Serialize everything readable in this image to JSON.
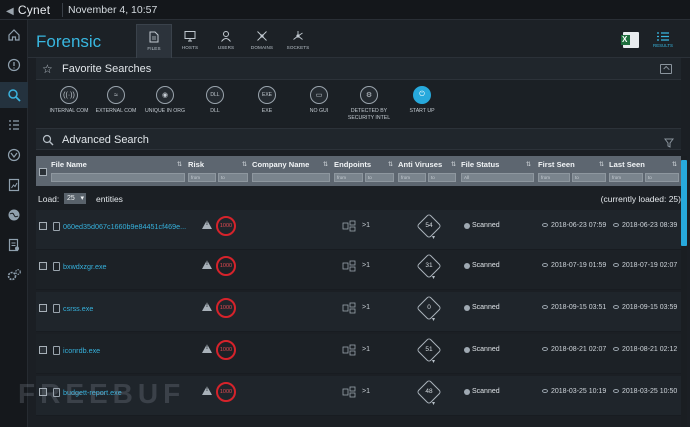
{
  "app": {
    "brand": "Cynet",
    "date": "November 4, 10:57"
  },
  "header": {
    "title": "Forensic",
    "tabs": [
      {
        "label": "FILES",
        "active": true
      },
      {
        "label": "HOSTS"
      },
      {
        "label": "USERS"
      },
      {
        "label": "DOMAINS"
      },
      {
        "label": "SOCKETS"
      }
    ],
    "results_label": "RESULTS"
  },
  "sidebar": {
    "icons": [
      "home-icon",
      "alert-icon",
      "search-icon",
      "list-icon",
      "target-icon",
      "report-icon",
      "globe-icon",
      "document-icon",
      "settings-icon"
    ],
    "active": 2
  },
  "favorites": {
    "title": "Favorite Searches",
    "items": [
      {
        "label": "INTERNAL COM",
        "glyph": "((·))"
      },
      {
        "label": "EXTERNAL COM",
        "glyph": "≈"
      },
      {
        "label": "UNIQUE IN ORG",
        "glyph": "◉"
      },
      {
        "label": "DLL",
        "glyph": "DLL"
      },
      {
        "label": "EXE",
        "glyph": "EXE"
      },
      {
        "label": "NO GUI",
        "glyph": "▭"
      },
      {
        "label": "DETECTED BY SECURITY INTEL",
        "glyph": "⚙"
      },
      {
        "label": "START UP",
        "glyph": "⏻",
        "active": true
      }
    ]
  },
  "advanced": {
    "title": "Advanced Search"
  },
  "table": {
    "columns": [
      "File Name",
      "Risk",
      "Company Name",
      "Endpoints",
      "Anti Viruses",
      "File Status",
      "First Seen",
      "Last Seen"
    ],
    "filters": {
      "risk_from": "from",
      "risk_to": "to",
      "ep_from": "from",
      "ep_to": "to",
      "av_from": "from",
      "av_to": "to",
      "status": "All",
      "fs_from": "from",
      "fs_to": "to",
      "ls_from": "from",
      "ls_to": "to"
    },
    "load_label": "Load:",
    "load_value": "25",
    "entities_label": "entities",
    "loaded_text": "(currently loaded: 25)",
    "rows": [
      {
        "name": "060ed35d067c1660b9e84451cf469e...",
        "risk": "1000",
        "endpoints": "1",
        "av": "54",
        "status": "Scanned",
        "first": "2018-06-23 07:59",
        "last": "2018-06-23 08:39"
      },
      {
        "name": "bxwdxzgr.exe",
        "risk": "1000",
        "endpoints": "1",
        "av": "31",
        "status": "Scanned",
        "first": "2018-07-19 01:59",
        "last": "2018-07-19 02:07"
      },
      {
        "name": "csrss.exe",
        "risk": "1000",
        "endpoints": "1",
        "av": "0",
        "status": "Scanned",
        "first": "2018-09-15 03:51",
        "last": "2018-09-15 03:59"
      },
      {
        "name": "iconrdb.exe",
        "risk": "1000",
        "endpoints": "1",
        "av": "51",
        "status": "Scanned",
        "first": "2018-08-21 02:07",
        "last": "2018-08-21 02:12"
      },
      {
        "name": "budgett-report.exe",
        "risk": "1000",
        "endpoints": "1",
        "av": "48",
        "status": "Scanned",
        "first": "2018-03-25 10:19",
        "last": "2018-03-25 10:50"
      }
    ]
  },
  "watermark": "FREEBUF"
}
